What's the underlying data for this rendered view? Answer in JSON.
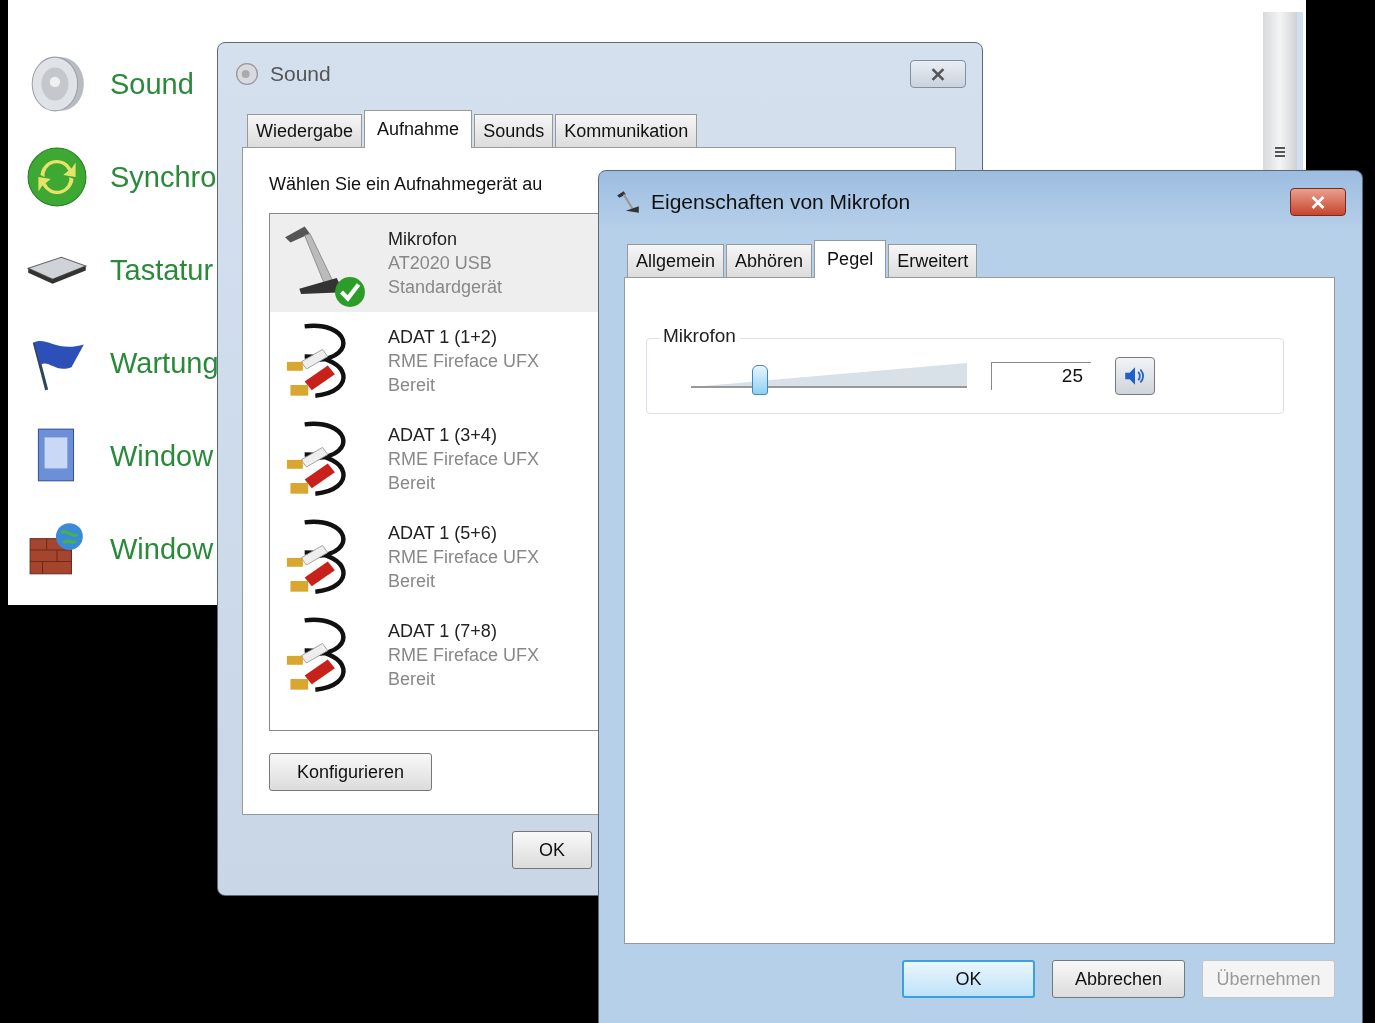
{
  "control_panel": {
    "items": [
      {
        "label": "Sound",
        "kind": "speaker"
      },
      {
        "label": "Synchro",
        "kind": "sync"
      },
      {
        "label": "Tastatur",
        "kind": "keyboard"
      },
      {
        "label": "Wartung",
        "kind": "flag"
      },
      {
        "label": "Window",
        "kind": "document"
      },
      {
        "label": "Window",
        "kind": "wall"
      }
    ]
  },
  "sound_dialog": {
    "title": "Sound",
    "tabs": [
      {
        "label": "Wiedergabe",
        "selected": false
      },
      {
        "label": "Aufnahme",
        "selected": true
      },
      {
        "label": "Sounds",
        "selected": false
      },
      {
        "label": "Kommunikation",
        "selected": false
      }
    ],
    "prompt": "Wählen Sie ein Aufnahmegerät au",
    "devices": [
      {
        "kind": "microphone",
        "name": "Mikrofon",
        "model": "AT2020 USB",
        "status": "Standardgerät",
        "default": true,
        "selected": true
      },
      {
        "kind": "cable",
        "name": "ADAT 1 (1+2)",
        "model": "RME Fireface UFX",
        "status": "Bereit",
        "default": false,
        "selected": false
      },
      {
        "kind": "cable",
        "name": "ADAT 1 (3+4)",
        "model": "RME Fireface UFX",
        "status": "Bereit",
        "default": false,
        "selected": false
      },
      {
        "kind": "cable",
        "name": "ADAT 1 (5+6)",
        "model": "RME Fireface UFX",
        "status": "Bereit",
        "default": false,
        "selected": false
      },
      {
        "kind": "cable",
        "name": "ADAT 1 (7+8)",
        "model": "RME Fireface UFX",
        "status": "Bereit",
        "default": false,
        "selected": false
      }
    ],
    "configure_button": "Konfigurieren",
    "ok_button": "OK"
  },
  "properties_dialog": {
    "title": "Eigenschaften von Mikrofon",
    "tabs": [
      {
        "label": "Allgemein",
        "selected": false
      },
      {
        "label": "Abhören",
        "selected": false
      },
      {
        "label": "Pegel",
        "selected": true
      },
      {
        "label": "Erweitert",
        "selected": false
      }
    ],
    "group_label": "Mikrofon",
    "slider": {
      "level": 0.25
    },
    "value": "25",
    "muted": false,
    "buttons": [
      {
        "label": "OK",
        "default": true,
        "disabled": false
      },
      {
        "label": "Abbrechen",
        "default": false,
        "disabled": false
      },
      {
        "label": "Übernehmen",
        "default": false,
        "disabled": true
      }
    ]
  }
}
